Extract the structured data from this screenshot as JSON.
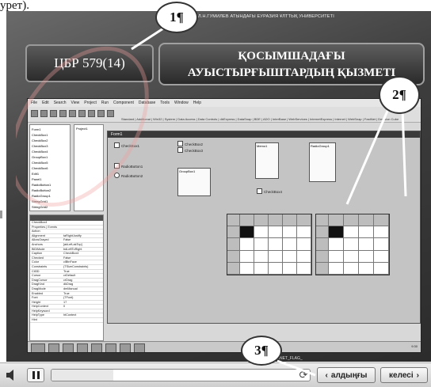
{
  "page": {
    "top_text": "урет)."
  },
  "slide": {
    "university": "Л.Н.ГУМИЛЕВ АТЫНДАҒЫ ЕУРАЗИЯ ҰЛТТЫҚ УНИВЕРСИТЕТІ",
    "code": "ЦБР 579(14)",
    "title_line1": "ҚОСЫМШАДАҒЫ",
    "title_line2": "АУЫСТЫРҒЫШТАРДЫҢ ҚЫЗМЕТІ",
    "markers": [
      "1¶",
      "2¶",
      "3¶"
    ],
    "footer_text": "INTERNET_FLAG_"
  },
  "ide": {
    "menu": [
      "File",
      "Edit",
      "Search",
      "View",
      "Project",
      "Run",
      "Component",
      "Database",
      "Tools",
      "Window",
      "Help"
    ],
    "combo_value": "None",
    "palette_tabs": "Standard | Additional | Win32 | System | Data Access | Data Controls | dbExpress | DataSnap | BDE | ADO | InterBase | WebServices | InternetExpress | Internet | WebSnap | FastNet | Decision Cube",
    "tree_items": [
      "Form1",
      "CheckBox1",
      "CheckBox2",
      "CheckBox3",
      "CheckBox4",
      "GroupBox1",
      "CheckBox5",
      "CheckBox6",
      "Edit1",
      "Panel1",
      "RadioButton1",
      "RadioButton2",
      "RadioGroup1",
      "StringGrid1",
      "StringGrid2"
    ],
    "unit_tab": "Project1",
    "inspector_object": "CheckBox4",
    "inspector_tabs": "Properties | Events",
    "properties": [
      [
        "Action",
        ""
      ],
      [
        "Alignment",
        "taRightJustify"
      ],
      [
        "AllowGrayed",
        "False"
      ],
      [
        "Anchors",
        "[akLeft,akTop]"
      ],
      [
        "BiDiMode",
        "bdLeftToRight"
      ],
      [
        "Caption",
        "CheckBox4"
      ],
      [
        "Checked",
        "False"
      ],
      [
        "Color",
        "clBtnFace"
      ],
      [
        "Constraints",
        "(TSizeConstraints)"
      ],
      [
        "Ctl3D",
        "True"
      ],
      [
        "Cursor",
        "crDefault"
      ],
      [
        "DragCursor",
        "crDrag"
      ],
      [
        "DragKind",
        "dkDrag"
      ],
      [
        "DragMode",
        "dmManual"
      ],
      [
        "Enabled",
        "True"
      ],
      [
        "Font",
        "(TFont)"
      ],
      [
        "Height",
        "17"
      ],
      [
        "HelpContext",
        "0"
      ],
      [
        "HelpKeyword",
        ""
      ],
      [
        "HelpType",
        "htContext"
      ],
      [
        "Hint",
        ""
      ]
    ],
    "form_title": "Form1",
    "controls": {
      "cb1": "CheckBox1",
      "cb2": "CheckBox2",
      "cb3": "CheckBox3",
      "rb1": "RadioButton1",
      "rb2": "RadioButton2",
      "memo": "Memo1",
      "group": "GroupBox1",
      "panel": "Panel1",
      "radiogroup": "RadioGroup1",
      "cb_bottom": "CheckBox4"
    },
    "clock": "9:30"
  },
  "player": {
    "prev_label": "алдыңғы",
    "next_label": "келесі",
    "progress_fraction": 0.24
  }
}
